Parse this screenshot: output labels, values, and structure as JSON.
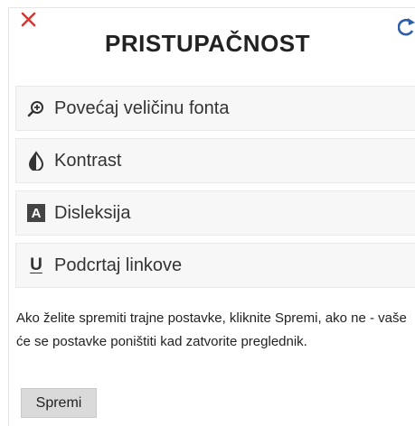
{
  "panel": {
    "close_glyph": "✕",
    "reset_icon": "refresh-icon",
    "title": "PRISTUPAČNOST"
  },
  "options": [
    {
      "icon": "zoom-in-icon",
      "label": "Povećaj veličinu fonta"
    },
    {
      "icon": "contrast-icon",
      "label": "Kontrast"
    },
    {
      "icon": "dyslexia-a-icon",
      "icon_text": "A",
      "label": "Disleksija"
    },
    {
      "icon": "underline-icon",
      "icon_text": "U",
      "label": "Podcrtaj linkove"
    }
  ],
  "info": {
    "text": "Ako želite spremiti trajne postavke, kliknite Spremi, ako ne - vaše će se postavke poništiti kad zatvorite preglednik."
  },
  "save_button": {
    "label": "Spremi"
  },
  "colors": {
    "close": "#e0332f",
    "reset": "#2d5fa8",
    "option_bg": "#f7f7f7",
    "button_bg": "#dadada"
  }
}
